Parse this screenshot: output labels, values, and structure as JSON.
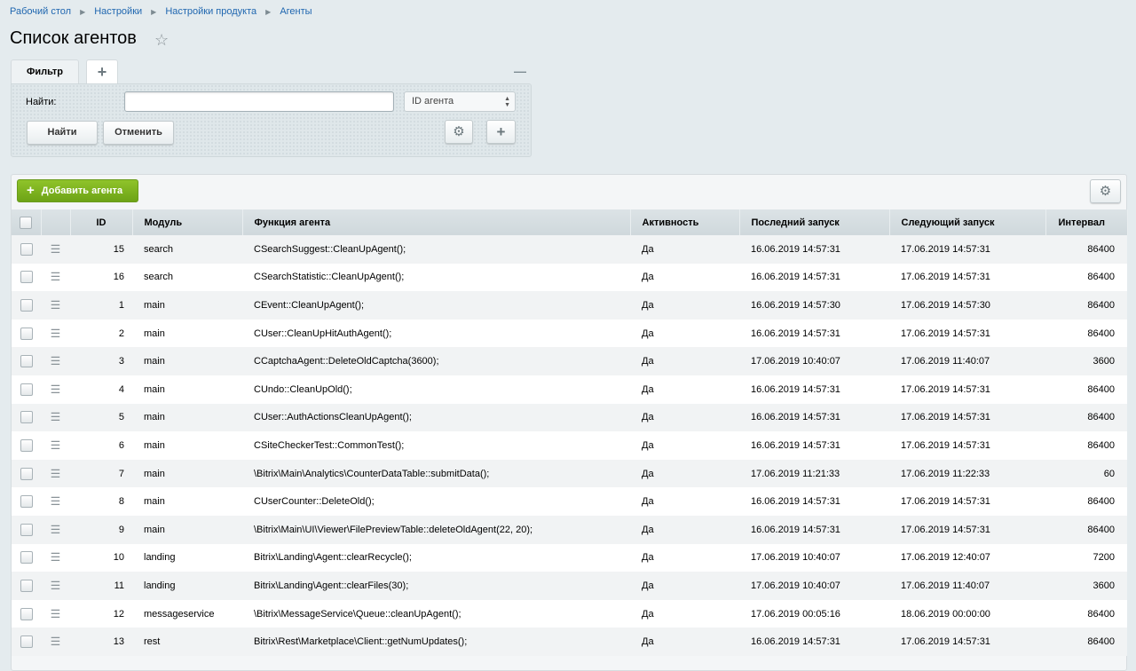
{
  "breadcrumb": [
    "Рабочий стол",
    "Настройки",
    "Настройки продукта",
    "Агенты"
  ],
  "page_title": "Список агентов",
  "filter": {
    "tab_label": "Фильтр",
    "find_label": "Найти:",
    "search_value": "",
    "select_value": "ID агента",
    "find_button": "Найти",
    "cancel_button": "Отменить"
  },
  "toolbar": {
    "add_button": "Добавить агента"
  },
  "table": {
    "columns": [
      "ID",
      "Модуль",
      "Функция агента",
      "Активность",
      "Последний запуск",
      "Следующий запуск",
      "Интервал"
    ],
    "rows": [
      {
        "id": "15",
        "module": "search",
        "func": "CSearchSuggest::CleanUpAgent();",
        "active": "Да",
        "last": "16.06.2019 14:57:31",
        "next": "17.06.2019 14:57:31",
        "interval": "86400"
      },
      {
        "id": "16",
        "module": "search",
        "func": "CSearchStatistic::CleanUpAgent();",
        "active": "Да",
        "last": "16.06.2019 14:57:31",
        "next": "17.06.2019 14:57:31",
        "interval": "86400"
      },
      {
        "id": "1",
        "module": "main",
        "func": "CEvent::CleanUpAgent();",
        "active": "Да",
        "last": "16.06.2019 14:57:30",
        "next": "17.06.2019 14:57:30",
        "interval": "86400"
      },
      {
        "id": "2",
        "module": "main",
        "func": "CUser::CleanUpHitAuthAgent();",
        "active": "Да",
        "last": "16.06.2019 14:57:31",
        "next": "17.06.2019 14:57:31",
        "interval": "86400"
      },
      {
        "id": "3",
        "module": "main",
        "func": "CCaptchaAgent::DeleteOldCaptcha(3600);",
        "active": "Да",
        "last": "17.06.2019 10:40:07",
        "next": "17.06.2019 11:40:07",
        "interval": "3600"
      },
      {
        "id": "4",
        "module": "main",
        "func": "CUndo::CleanUpOld();",
        "active": "Да",
        "last": "16.06.2019 14:57:31",
        "next": "17.06.2019 14:57:31",
        "interval": "86400"
      },
      {
        "id": "5",
        "module": "main",
        "func": "CUser::AuthActionsCleanUpAgent();",
        "active": "Да",
        "last": "16.06.2019 14:57:31",
        "next": "17.06.2019 14:57:31",
        "interval": "86400"
      },
      {
        "id": "6",
        "module": "main",
        "func": "CSiteCheckerTest::CommonTest();",
        "active": "Да",
        "last": "16.06.2019 14:57:31",
        "next": "17.06.2019 14:57:31",
        "interval": "86400"
      },
      {
        "id": "7",
        "module": "main",
        "func": "\\Bitrix\\Main\\Analytics\\CounterDataTable::submitData();",
        "active": "Да",
        "last": "17.06.2019 11:21:33",
        "next": "17.06.2019 11:22:33",
        "interval": "60"
      },
      {
        "id": "8",
        "module": "main",
        "func": "CUserCounter::DeleteOld();",
        "active": "Да",
        "last": "16.06.2019 14:57:31",
        "next": "17.06.2019 14:57:31",
        "interval": "86400"
      },
      {
        "id": "9",
        "module": "main",
        "func": "\\Bitrix\\Main\\UI\\Viewer\\FilePreviewTable::deleteOldAgent(22, 20);",
        "active": "Да",
        "last": "16.06.2019 14:57:31",
        "next": "17.06.2019 14:57:31",
        "interval": "86400"
      },
      {
        "id": "10",
        "module": "landing",
        "func": "Bitrix\\Landing\\Agent::clearRecycle();",
        "active": "Да",
        "last": "17.06.2019 10:40:07",
        "next": "17.06.2019 12:40:07",
        "interval": "7200"
      },
      {
        "id": "11",
        "module": "landing",
        "func": "Bitrix\\Landing\\Agent::clearFiles(30);",
        "active": "Да",
        "last": "17.06.2019 10:40:07",
        "next": "17.06.2019 11:40:07",
        "interval": "3600"
      },
      {
        "id": "12",
        "module": "messageservice",
        "func": "\\Bitrix\\MessageService\\Queue::cleanUpAgent();",
        "active": "Да",
        "last": "17.06.2019 00:05:16",
        "next": "18.06.2019 00:00:00",
        "interval": "86400"
      },
      {
        "id": "13",
        "module": "rest",
        "func": "Bitrix\\Rest\\Marketplace\\Client::getNumUpdates();",
        "active": "Да",
        "last": "16.06.2019 14:57:31",
        "next": "17.06.2019 14:57:31",
        "interval": "86400"
      }
    ]
  }
}
